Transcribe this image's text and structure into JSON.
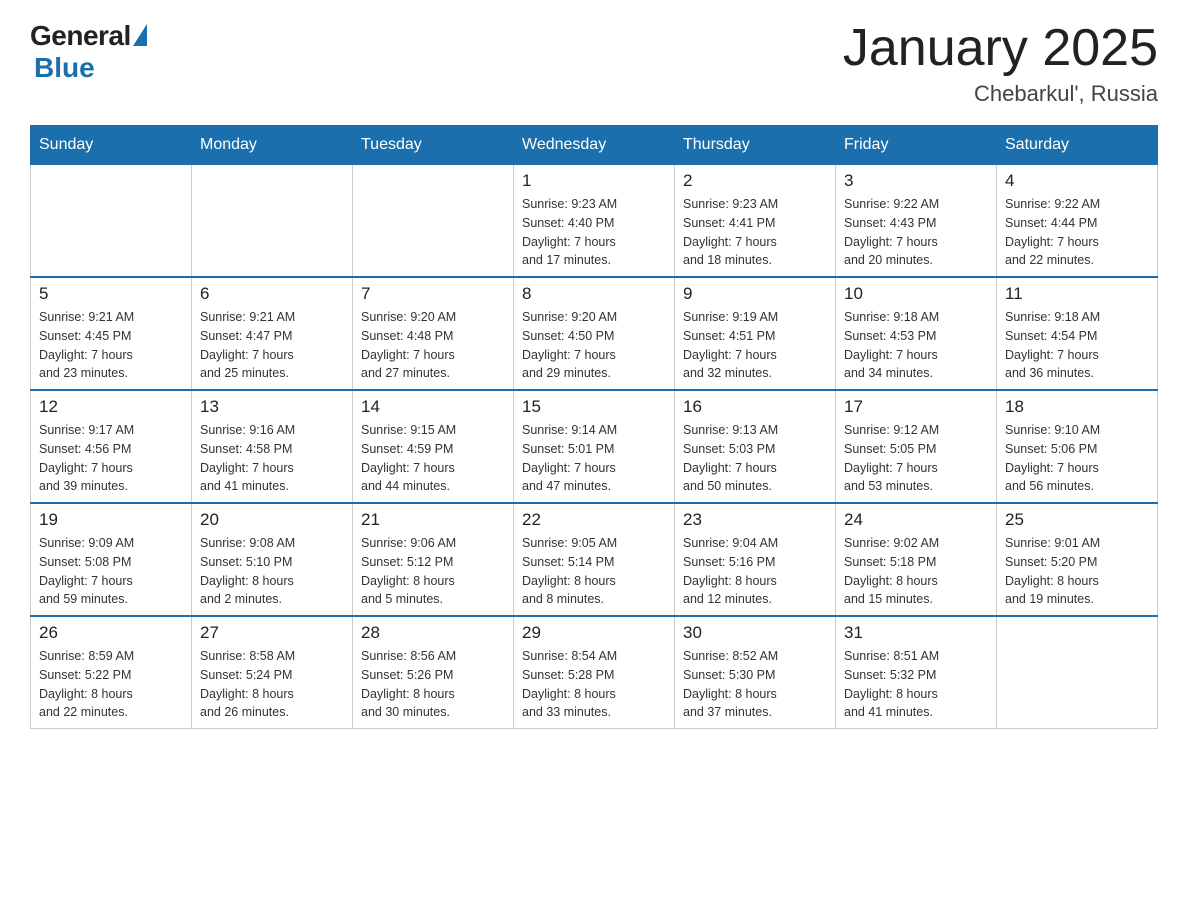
{
  "header": {
    "logo_general": "General",
    "logo_blue": "Blue",
    "title": "January 2025",
    "subtitle": "Chebarkul', Russia"
  },
  "weekdays": [
    "Sunday",
    "Monday",
    "Tuesday",
    "Wednesday",
    "Thursday",
    "Friday",
    "Saturday"
  ],
  "weeks": [
    [
      {
        "day": "",
        "info": ""
      },
      {
        "day": "",
        "info": ""
      },
      {
        "day": "",
        "info": ""
      },
      {
        "day": "1",
        "info": "Sunrise: 9:23 AM\nSunset: 4:40 PM\nDaylight: 7 hours\nand 17 minutes."
      },
      {
        "day": "2",
        "info": "Sunrise: 9:23 AM\nSunset: 4:41 PM\nDaylight: 7 hours\nand 18 minutes."
      },
      {
        "day": "3",
        "info": "Sunrise: 9:22 AM\nSunset: 4:43 PM\nDaylight: 7 hours\nand 20 minutes."
      },
      {
        "day": "4",
        "info": "Sunrise: 9:22 AM\nSunset: 4:44 PM\nDaylight: 7 hours\nand 22 minutes."
      }
    ],
    [
      {
        "day": "5",
        "info": "Sunrise: 9:21 AM\nSunset: 4:45 PM\nDaylight: 7 hours\nand 23 minutes."
      },
      {
        "day": "6",
        "info": "Sunrise: 9:21 AM\nSunset: 4:47 PM\nDaylight: 7 hours\nand 25 minutes."
      },
      {
        "day": "7",
        "info": "Sunrise: 9:20 AM\nSunset: 4:48 PM\nDaylight: 7 hours\nand 27 minutes."
      },
      {
        "day": "8",
        "info": "Sunrise: 9:20 AM\nSunset: 4:50 PM\nDaylight: 7 hours\nand 29 minutes."
      },
      {
        "day": "9",
        "info": "Sunrise: 9:19 AM\nSunset: 4:51 PM\nDaylight: 7 hours\nand 32 minutes."
      },
      {
        "day": "10",
        "info": "Sunrise: 9:18 AM\nSunset: 4:53 PM\nDaylight: 7 hours\nand 34 minutes."
      },
      {
        "day": "11",
        "info": "Sunrise: 9:18 AM\nSunset: 4:54 PM\nDaylight: 7 hours\nand 36 minutes."
      }
    ],
    [
      {
        "day": "12",
        "info": "Sunrise: 9:17 AM\nSunset: 4:56 PM\nDaylight: 7 hours\nand 39 minutes."
      },
      {
        "day": "13",
        "info": "Sunrise: 9:16 AM\nSunset: 4:58 PM\nDaylight: 7 hours\nand 41 minutes."
      },
      {
        "day": "14",
        "info": "Sunrise: 9:15 AM\nSunset: 4:59 PM\nDaylight: 7 hours\nand 44 minutes."
      },
      {
        "day": "15",
        "info": "Sunrise: 9:14 AM\nSunset: 5:01 PM\nDaylight: 7 hours\nand 47 minutes."
      },
      {
        "day": "16",
        "info": "Sunrise: 9:13 AM\nSunset: 5:03 PM\nDaylight: 7 hours\nand 50 minutes."
      },
      {
        "day": "17",
        "info": "Sunrise: 9:12 AM\nSunset: 5:05 PM\nDaylight: 7 hours\nand 53 minutes."
      },
      {
        "day": "18",
        "info": "Sunrise: 9:10 AM\nSunset: 5:06 PM\nDaylight: 7 hours\nand 56 minutes."
      }
    ],
    [
      {
        "day": "19",
        "info": "Sunrise: 9:09 AM\nSunset: 5:08 PM\nDaylight: 7 hours\nand 59 minutes."
      },
      {
        "day": "20",
        "info": "Sunrise: 9:08 AM\nSunset: 5:10 PM\nDaylight: 8 hours\nand 2 minutes."
      },
      {
        "day": "21",
        "info": "Sunrise: 9:06 AM\nSunset: 5:12 PM\nDaylight: 8 hours\nand 5 minutes."
      },
      {
        "day": "22",
        "info": "Sunrise: 9:05 AM\nSunset: 5:14 PM\nDaylight: 8 hours\nand 8 minutes."
      },
      {
        "day": "23",
        "info": "Sunrise: 9:04 AM\nSunset: 5:16 PM\nDaylight: 8 hours\nand 12 minutes."
      },
      {
        "day": "24",
        "info": "Sunrise: 9:02 AM\nSunset: 5:18 PM\nDaylight: 8 hours\nand 15 minutes."
      },
      {
        "day": "25",
        "info": "Sunrise: 9:01 AM\nSunset: 5:20 PM\nDaylight: 8 hours\nand 19 minutes."
      }
    ],
    [
      {
        "day": "26",
        "info": "Sunrise: 8:59 AM\nSunset: 5:22 PM\nDaylight: 8 hours\nand 22 minutes."
      },
      {
        "day": "27",
        "info": "Sunrise: 8:58 AM\nSunset: 5:24 PM\nDaylight: 8 hours\nand 26 minutes."
      },
      {
        "day": "28",
        "info": "Sunrise: 8:56 AM\nSunset: 5:26 PM\nDaylight: 8 hours\nand 30 minutes."
      },
      {
        "day": "29",
        "info": "Sunrise: 8:54 AM\nSunset: 5:28 PM\nDaylight: 8 hours\nand 33 minutes."
      },
      {
        "day": "30",
        "info": "Sunrise: 8:52 AM\nSunset: 5:30 PM\nDaylight: 8 hours\nand 37 minutes."
      },
      {
        "day": "31",
        "info": "Sunrise: 8:51 AM\nSunset: 5:32 PM\nDaylight: 8 hours\nand 41 minutes."
      },
      {
        "day": "",
        "info": ""
      }
    ]
  ]
}
